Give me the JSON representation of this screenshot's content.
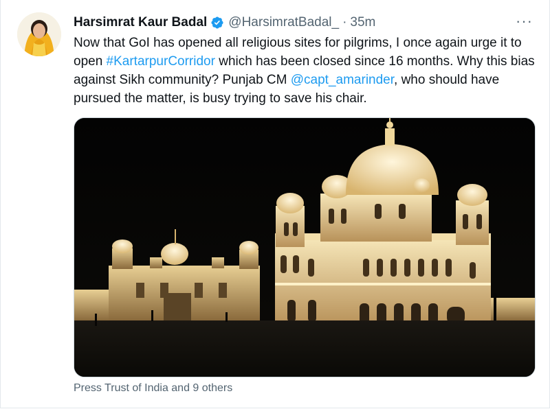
{
  "tweet": {
    "author_name": "Harsimrat Kaur Badal",
    "handle": "@HarsimratBadal_",
    "separator": "·",
    "time": "35m",
    "more_label": "···",
    "text_parts": [
      "Now that GoI has opened all religious sites for pilgrims, I once again urge it to open ",
      "#KartarpurCorridor",
      " which has been closed since 16 months. Why this bias against Sikh community? Punjab CM ",
      "@capt_amarinder",
      ", who should have pursued the matter, is busy trying to save his chair."
    ],
    "tagged_users": "Press Trust of India and 9 others",
    "icons": {
      "verified": "verified-badge-icon",
      "more": "more-options-icon"
    }
  },
  "colors": {
    "link": "#1d9bf0",
    "secondary_text": "#536471",
    "verified_badge": "#1d9bf0"
  }
}
